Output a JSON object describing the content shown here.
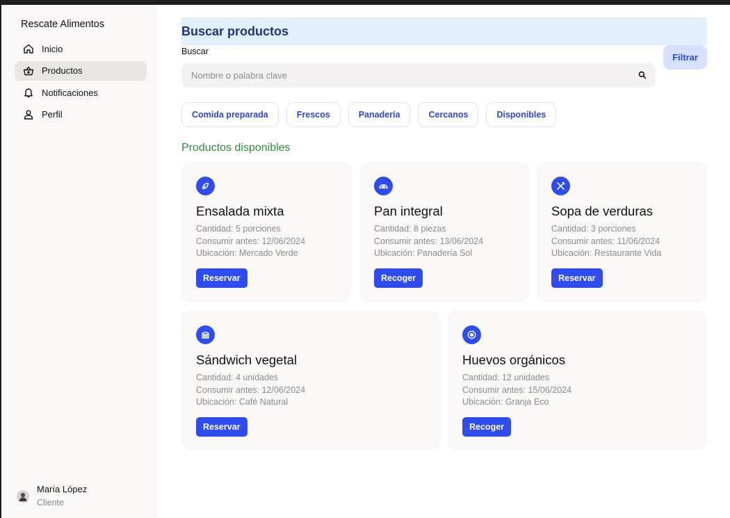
{
  "sidebar": {
    "brand": "Rescate Alimentos",
    "items": [
      {
        "label": "Inicio",
        "icon": "home-icon"
      },
      {
        "label": "Productos",
        "icon": "basket-icon"
      },
      {
        "label": "Notificaciones",
        "icon": "bell-icon"
      },
      {
        "label": "Perfil",
        "icon": "user-icon"
      }
    ],
    "active_item": "Productos",
    "user": {
      "name": "María López",
      "role": "Cliente"
    }
  },
  "search": {
    "title": "Buscar productos",
    "label": "Buscar",
    "placeholder": "Nombre o palabra clave",
    "filter_label": "Filtrar"
  },
  "chips": [
    "Comida preparada",
    "Frescos",
    "Panadería",
    "Cercanos",
    "Disponibles"
  ],
  "products": {
    "title": "Productos disponibles",
    "items": [
      {
        "name": "Ensalada mixta",
        "quantity": "Cantidad: 5 porciones",
        "expiry": "Consumir antes: 12/06/2024",
        "location": "Ubicación: Mercado Verde",
        "action": "Reservar",
        "icon": "leaf-icon"
      },
      {
        "name": "Pan integral",
        "quantity": "Cantidad: 8 piezas",
        "expiry": "Consumir antes: 13/06/2024",
        "location": "Ubicación: Panadería Sol",
        "action": "Recoger",
        "icon": "bread-icon"
      },
      {
        "name": "Sopa de verduras",
        "quantity": "Cantidad: 3 porciones",
        "expiry": "Consumir antes: 11/06/2024",
        "location": "Ubicación: Restaurante Vida",
        "action": "Reservar",
        "icon": "utensils-icon"
      },
      {
        "name": "Sándwich vegetal",
        "quantity": "Cantidad: 4 unidades",
        "expiry": "Consumir antes: 12/06/2024",
        "location": "Ubicación: Café Natural",
        "action": "Reservar",
        "icon": "sandwich-icon"
      },
      {
        "name": "Huevos orgánicos",
        "quantity": "Cantidad: 12 unidades",
        "expiry": "Consumir antes: 15/06/2024",
        "location": "Ubicación: Granja Eco",
        "action": "Recoger",
        "icon": "egg-icon"
      }
    ]
  },
  "colors": {
    "accent": "#2e4cf0",
    "header_bg": "#e2efff",
    "section_title": "#2e8b3b",
    "card_bg": "#f9f8f6"
  }
}
